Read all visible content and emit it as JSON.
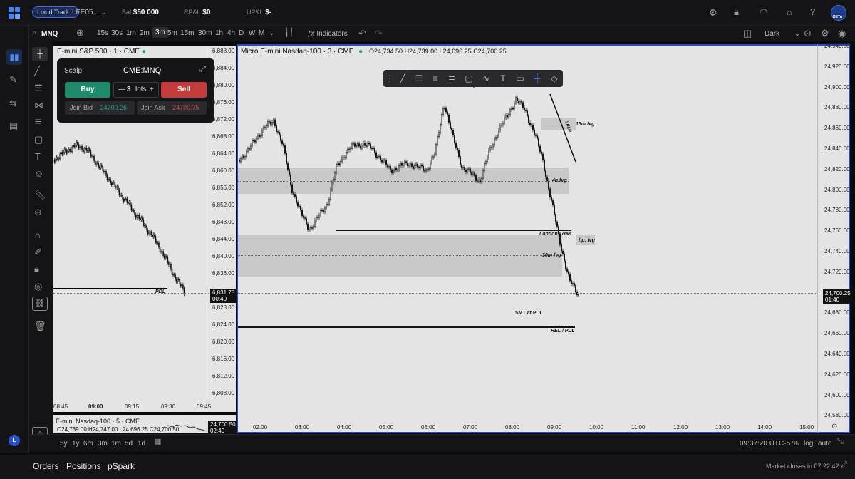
{
  "topbar": {
    "account_pill": "Lucid Tradi...",
    "account_id": "LFE05...",
    "bal_label": "Bal",
    "bal_value": "$50 000",
    "rpl_label": "RP&L",
    "rpl_value": "$0",
    "upl_label": "UP&L",
    "upl_value": "$-",
    "avatar_badge": "BETA"
  },
  "toolbar": {
    "symbol": "MNQ",
    "timeframes": [
      "15s",
      "30s",
      "1m",
      "2m",
      "3m",
      "5m",
      "15m",
      "30m",
      "1h",
      "4h",
      "D",
      "W",
      "M"
    ],
    "active_timeframe": "3m",
    "indicators_label": "Indicators",
    "theme_label": "Dark"
  },
  "left_chart": {
    "title": "E-mini S&P 500 · 1 · CME",
    "price_ticks": [
      "6,888.00",
      "6,884.00",
      "6,880.00",
      "6,876.00",
      "6,872.00",
      "6,868.00",
      "6,864.00",
      "6,860.00",
      "6,856.00",
      "6,852.00",
      "6,848.00",
      "6,844.00",
      "6,840.00",
      "6,836.00",
      "6,828.00",
      "6,824.00",
      "6,820.00",
      "6,816.00",
      "6,812.00",
      "6,808.00"
    ],
    "current_price": "6,831.75",
    "countdown": "00:40",
    "time_ticks": [
      "08:45",
      "09:00",
      "09:15",
      "09:30",
      "09:45"
    ],
    "pdl_label": "PDL"
  },
  "scalp_panel": {
    "title": "Scalp",
    "symbol": "CME:MNQ",
    "buy_label": "Buy",
    "sell_label": "Sell",
    "qty": "3",
    "qty_unit": "lots",
    "join_bid_label": "Join Bid",
    "join_bid_price": "24700.25",
    "join_ask_label": "Join Ask",
    "join_ask_price": "24700.75"
  },
  "bottom_left_chart": {
    "title": "E-mini Nasdaq-100 · 5 · CME",
    "ohlc": "O24,739.00 H24,747.00 L24,696.25 C24,700.50",
    "current_price": "24,700.50",
    "countdown": "02:40"
  },
  "main_chart": {
    "title": "Micro E-mini Nasdaq-100 · 3 · CME",
    "ohlc": {
      "o": "O24,734.50",
      "h": "H24,739.00",
      "l": "L24,696.25",
      "c": "C24,700.25"
    },
    "price_ticks": [
      "24,940.00",
      "24,920.00",
      "24,900.00",
      "24,880.00",
      "24,860.00",
      "24,840.00",
      "24,820.00",
      "24,800.00",
      "24,780.00",
      "24,760.00",
      "24,740.00",
      "24,720.00",
      "24,680.00",
      "24,660.00",
      "24,640.00",
      "24,620.00",
      "24,600.00",
      "24,580.00"
    ],
    "current_price": "24,700.25",
    "countdown": "01:40",
    "time_ticks": [
      "02:00",
      "03:00",
      "04:00",
      "05:00",
      "06:00",
      "07:00",
      "08:00",
      "09:00",
      "10:00",
      "11:00",
      "12:00",
      "13:00",
      "14:00",
      "15:00"
    ],
    "annotations": {
      "fvg_15m": "15m fvg",
      "fvg_4h": "4h fvg",
      "london_lows": "London Lows",
      "fp_fvg": "f.p. fvg",
      "fvg_30m": "30m fvg",
      "smt": "SMT at PDL",
      "rel_pdl": "REL / PDL",
      "trend_label": "LRLR"
    }
  },
  "bottombar": {
    "ranges": [
      "5y",
      "1y",
      "6m",
      "3m",
      "1m",
      "5d",
      "1d"
    ],
    "clock": "09:37:20 UTC-5",
    "pct": "%",
    "log": "log",
    "auto": "auto"
  },
  "footer": {
    "tabs": [
      "Orders",
      "Positions",
      "pSpark"
    ],
    "market_status": "Market closes in 07:22:42"
  },
  "user_initial": "L"
}
